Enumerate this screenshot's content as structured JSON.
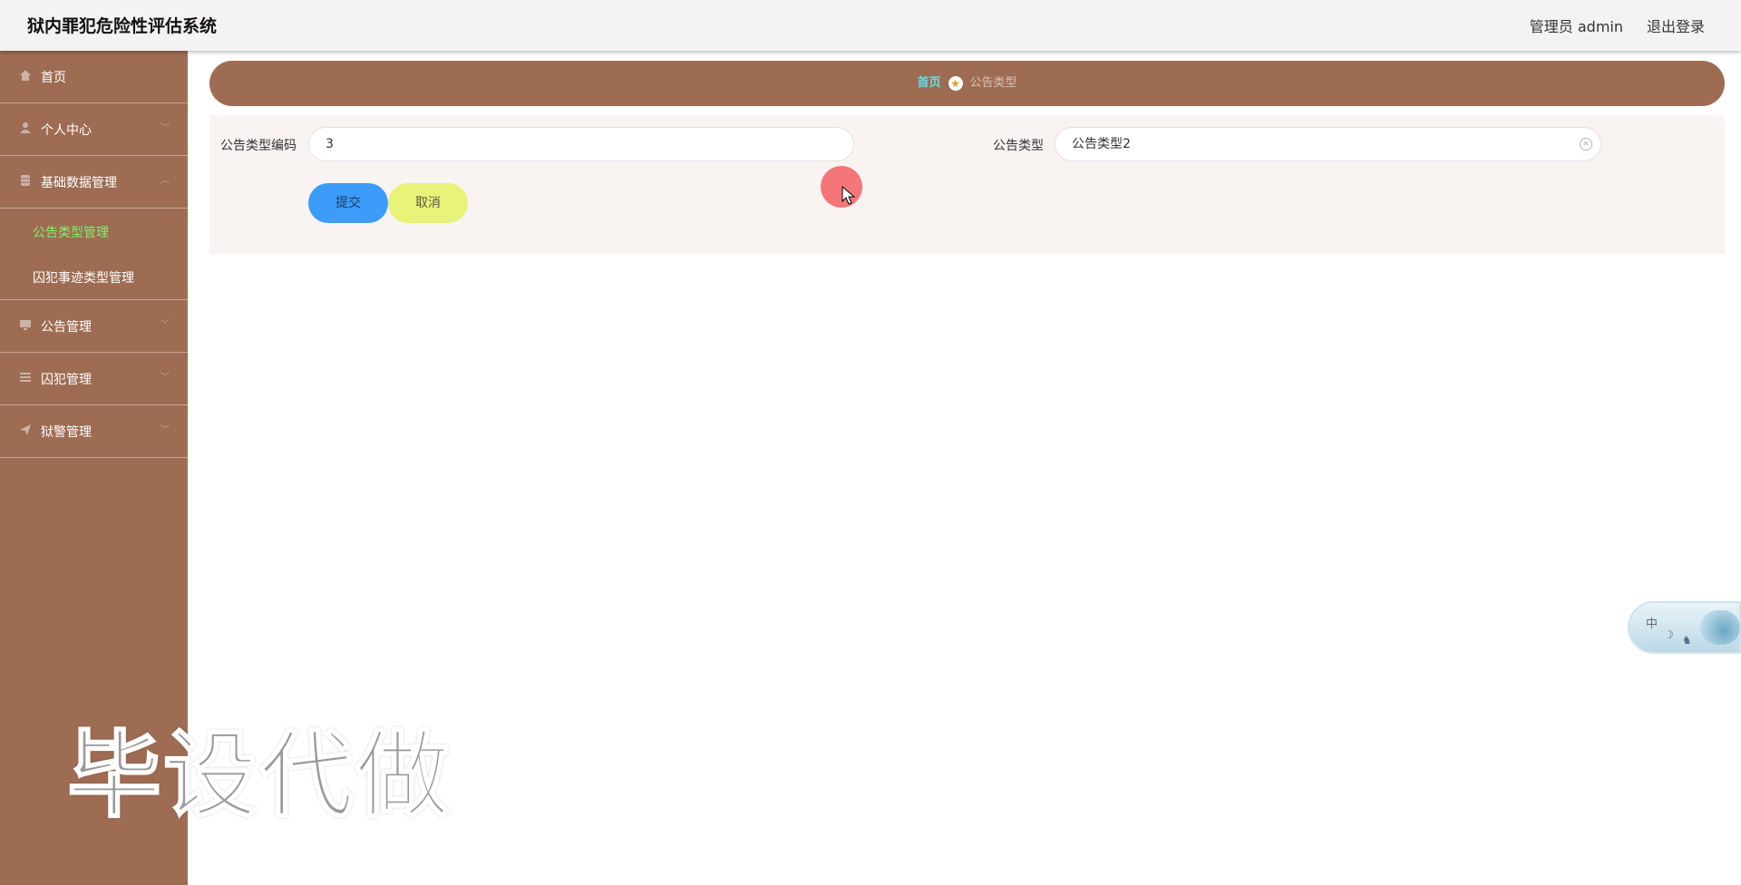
{
  "header": {
    "app_title": "狱内罪犯危险性评估系统",
    "user_info": "管理员 admin",
    "logout": "退出登录"
  },
  "sidebar": {
    "items": [
      {
        "label": "首页",
        "icon": "home-icon"
      },
      {
        "label": "个人中心",
        "icon": "user-icon"
      },
      {
        "label": "基础数据管理",
        "icon": "database-icon",
        "expanded": true,
        "children": [
          {
            "label": "公告类型管理",
            "active": true
          },
          {
            "label": "囚犯事迹类型管理",
            "active": false
          }
        ]
      },
      {
        "label": "公告管理",
        "icon": "monitor-icon"
      },
      {
        "label": "囚犯管理",
        "icon": "list-icon"
      },
      {
        "label": "狱警管理",
        "icon": "send-icon"
      }
    ]
  },
  "breadcrumb": {
    "home": "首页",
    "current": "公告类型"
  },
  "form": {
    "code_label": "公告类型编码",
    "code_value": "3",
    "type_label": "公告类型",
    "type_value": "公告类型2",
    "submit": "提交",
    "cancel": "取消"
  },
  "widget": {
    "lang": "中"
  },
  "watermark": "毕设代做",
  "colors": {
    "sidebar": "#9e6c53",
    "active_menu": "#7cf26c",
    "submit_button": "#3d9cf9",
    "cancel_button": "#e9f279",
    "breadcrumb_home": "#5fe0e8"
  }
}
